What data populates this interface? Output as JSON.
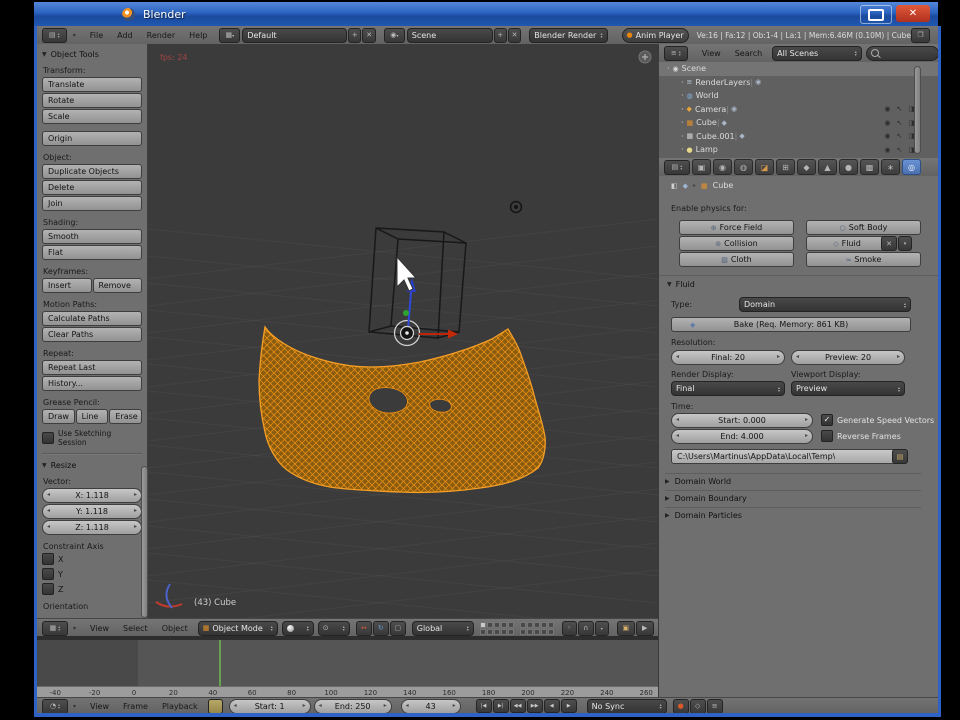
{
  "window": {
    "title": "Blender"
  },
  "infobar": {
    "menus": [
      "File",
      "Add",
      "Render",
      "Help"
    ],
    "layout_value": "Default",
    "scene_value": "Scene",
    "engine_value": "Blender Render",
    "anim_player_label": "Anim Player",
    "stats": "Ve:16 | Fa:12 | Ob:1-4 | La:1 | Mem:6.46M (0.10M) | Cube"
  },
  "tool_shelf": {
    "panel_title": "Object Tools",
    "groups": [
      {
        "label": "Transform:",
        "buttons": [
          "Translate",
          "Rotate",
          "Scale"
        ],
        "inline": false
      },
      {
        "label": "",
        "buttons": [
          "Origin"
        ],
        "inline": false
      },
      {
        "label": "Object:",
        "buttons": [
          "Duplicate Objects",
          "Delete",
          "Join"
        ],
        "inline": false
      },
      {
        "label": "Shading:",
        "buttons": [
          "Smooth",
          "Flat"
        ],
        "inline": false
      },
      {
        "label": "Keyframes:",
        "buttons": [
          "Insert",
          "Remove"
        ],
        "inline": true
      },
      {
        "label": "Motion Paths:",
        "buttons": [
          "Calculate Paths",
          "Clear Paths"
        ],
        "inline": false
      },
      {
        "label": "Repeat:",
        "buttons": [
          "Repeat Last",
          "History..."
        ],
        "inline": false
      },
      {
        "label": "Grease Pencil:",
        "buttons": [
          "Draw",
          "Line",
          "Erase"
        ],
        "inline": true
      }
    ],
    "sketching_label": "Use Sketching Session",
    "resize": {
      "panel_title": "Resize",
      "vector_label": "Vector:",
      "fields": [
        "X: 1.118",
        "Y: 1.118",
        "Z: 1.118"
      ],
      "constraint_label": "Constraint Axis",
      "axes": [
        "X",
        "Y",
        "Z"
      ],
      "orientation_label": "Orientation"
    }
  },
  "viewport": {
    "fps": "fps: 24",
    "active_object": "(43) Cube"
  },
  "viewport_header": {
    "menus": [
      "View",
      "Select",
      "Object"
    ],
    "mode_value": "Object Mode",
    "orientation_value": "Global"
  },
  "outliner": {
    "menus": [
      "View",
      "Search"
    ],
    "filter_value": "All Scenes",
    "rows": [
      {
        "name": "Scene",
        "icon": "scene-icon",
        "glyph": "◉",
        "color": "#d8d8d8",
        "indent": 0,
        "selected": true,
        "restrict": false,
        "extra": ""
      },
      {
        "name": "RenderLayers",
        "icon": "renderlayers-icon",
        "glyph": "≡",
        "color": "#bcc8dc",
        "indent": 1,
        "selected": false,
        "restrict": false,
        "extra": "◉"
      },
      {
        "name": "World",
        "icon": "world-icon",
        "glyph": "◍",
        "color": "#86b4e4",
        "indent": 1,
        "selected": false,
        "restrict": false,
        "extra": ""
      },
      {
        "name": "Camera",
        "icon": "camera-icon",
        "glyph": "◆",
        "color": "#e8a33c",
        "indent": 1,
        "selected": false,
        "restrict": true,
        "extra": "◉"
      },
      {
        "name": "Cube",
        "icon": "mesh-icon",
        "glyph": "▦",
        "color": "#e8922a",
        "indent": 1,
        "selected": false,
        "restrict": true,
        "extra": "◆"
      },
      {
        "name": "Cube.001",
        "icon": "mesh-icon",
        "glyph": "▦",
        "color": "#d8d8d8",
        "indent": 1,
        "selected": false,
        "restrict": true,
        "extra": "◆"
      },
      {
        "name": "Lamp",
        "icon": "lamp-icon",
        "glyph": "●",
        "color": "#e8d88a",
        "indent": 1,
        "selected": false,
        "restrict": true,
        "extra": ""
      }
    ],
    "restrict_icons": [
      {
        "name": "visibility-icon",
        "glyph": "◉"
      },
      {
        "name": "selectability-icon",
        "glyph": "↖"
      },
      {
        "name": "renderability-icon",
        "glyph": "◨"
      }
    ]
  },
  "properties": {
    "tabs": [
      {
        "name": "tab-render",
        "glyph": "▣"
      },
      {
        "name": "tab-scene",
        "glyph": "◉"
      },
      {
        "name": "tab-world",
        "glyph": "◍"
      },
      {
        "name": "tab-object",
        "glyph": "◪",
        "color": "#d89a4a"
      },
      {
        "name": "tab-constraints",
        "glyph": "⊞"
      },
      {
        "name": "tab-modifiers",
        "glyph": "◆"
      },
      {
        "name": "tab-object-data",
        "glyph": "▲"
      },
      {
        "name": "tab-material",
        "glyph": "●"
      },
      {
        "name": "tab-texture",
        "glyph": "▩"
      },
      {
        "name": "tab-particles",
        "glyph": "∗"
      },
      {
        "name": "tab-physics",
        "glyph": "◎",
        "active": true
      }
    ],
    "breadcrumb_object": "Cube",
    "enable_label": "Enable physics for:",
    "physics_buttons": {
      "left": [
        {
          "label": "Force Field",
          "glyph": "⊕"
        },
        {
          "label": "Collision",
          "glyph": "⊚"
        },
        {
          "label": "Cloth",
          "glyph": "▨"
        }
      ],
      "right": [
        {
          "label": "Soft Body",
          "glyph": "○"
        },
        {
          "label": "Fluid",
          "glyph": "◇",
          "extra": true
        },
        {
          "label": "Smoke",
          "glyph": "≈"
        }
      ]
    },
    "fluid": {
      "panel_title": "Fluid",
      "type_label": "Type:",
      "type_value": "Domain",
      "bake_label": "Bake (Req. Memory: 861 KB)",
      "resolution_label": "Resolution:",
      "final_value": "Final: 20",
      "preview_value": "Preview: 20",
      "render_display_label": "Render Display:",
      "render_display_value": "Final",
      "viewport_display_label": "Viewport Display:",
      "viewport_display_value": "Preview",
      "time_label": "Time:",
      "start_value": "Start: 0.000",
      "end_value": "End: 4.000",
      "speed_vectors_label": "Generate Speed Vectors",
      "speed_vectors_checked": true,
      "reverse_frames_label": "Reverse Frames",
      "reverse_frames_checked": false,
      "cache_path": "C:\\Users\\Martinus\\AppData\\Local\\Temp\\",
      "collapsed_panels": [
        "Domain World",
        "Domain Boundary",
        "Domain Particles"
      ]
    }
  },
  "timeline": {
    "ticks": [
      -40,
      -20,
      0,
      20,
      40,
      60,
      80,
      100,
      120,
      140,
      160,
      180,
      200,
      220,
      240,
      260
    ],
    "current_frame_value": 43,
    "menus": [
      "View",
      "Frame",
      "Playback"
    ],
    "start_value": "Start: 1",
    "end_value": "End: 250",
    "current_frame": "43",
    "sync_value": "No Sync",
    "playback_buttons": [
      {
        "name": "jump-to-start-button",
        "glyph": "|◀"
      },
      {
        "name": "jump-to-end-button",
        "glyph": "▶|"
      },
      {
        "name": "prev-keyframe-button",
        "glyph": "◀◀"
      },
      {
        "name": "next-keyframe-button",
        "glyph": "▶▶"
      },
      {
        "name": "play-reverse-button",
        "glyph": "◀"
      },
      {
        "name": "play-button",
        "glyph": "▶"
      }
    ]
  },
  "colors": {
    "accent_orange": "#e8850c",
    "mesh_wire": "#f09214",
    "current_frame_green": "#69a352",
    "active_tab_blue": "#5680c2"
  }
}
